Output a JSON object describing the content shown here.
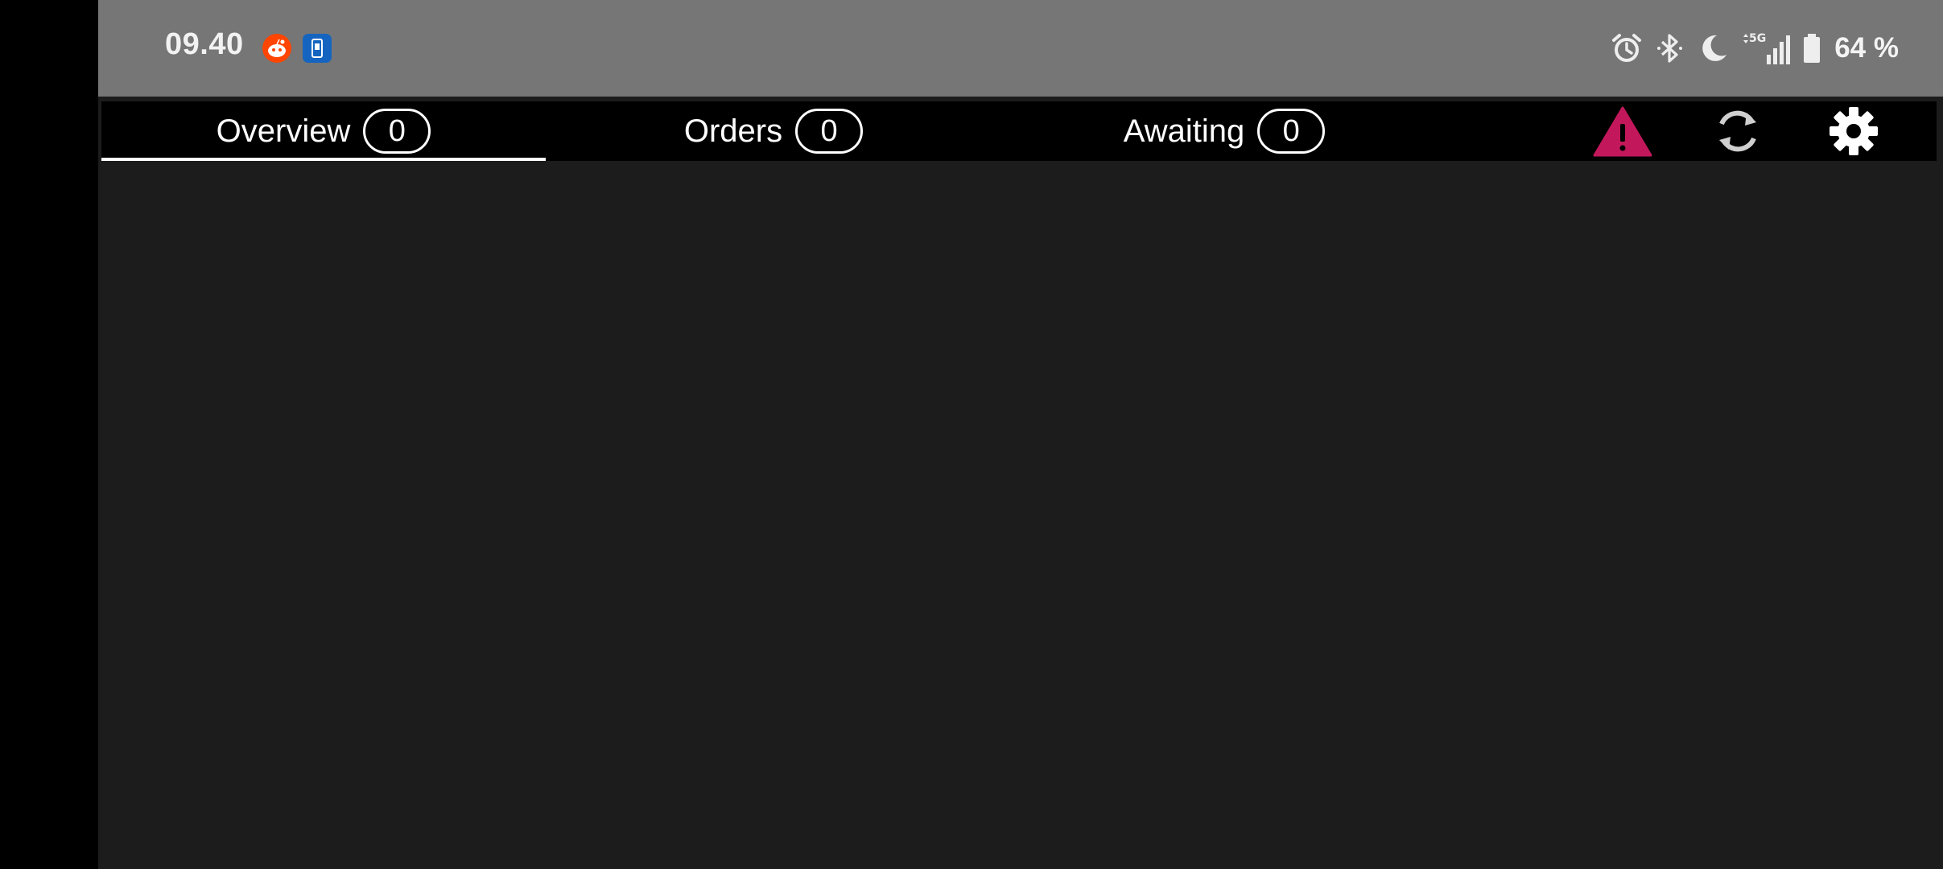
{
  "status_bar": {
    "time": "09.40",
    "battery": "64 %",
    "network": "5G",
    "icons": [
      "reddit-icon",
      "phone-app-icon",
      "alarm-icon",
      "bluetooth-icon",
      "do-not-disturb-icon",
      "signal-icon",
      "battery-icon"
    ]
  },
  "tabs": [
    {
      "label": "Overview",
      "count": "0",
      "active": true
    },
    {
      "label": "Orders",
      "count": "0",
      "active": false
    },
    {
      "label": "Awaiting",
      "count": "0",
      "active": false
    }
  ],
  "actions": {
    "icons": [
      "warning-icon",
      "sync-icon",
      "settings-icon"
    ]
  },
  "colors": {
    "status_bar_bg": "#767676",
    "tab_bar_bg": "#000000",
    "content_bg": "#1c1c1c",
    "warning": "#c2185b",
    "reddit": "#ff4500",
    "phone_app": "#1565c0"
  }
}
